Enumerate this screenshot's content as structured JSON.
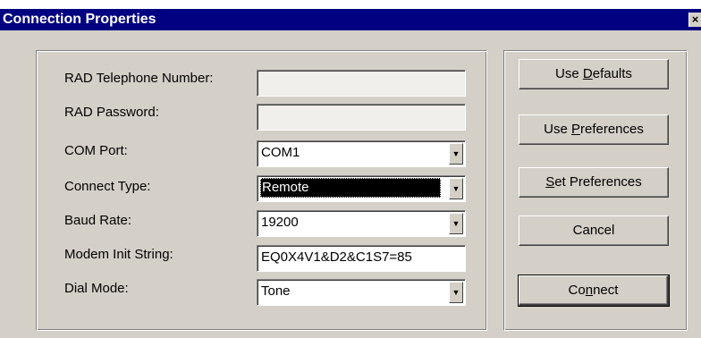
{
  "window": {
    "title": "Connection Properties",
    "close_glyph": "×"
  },
  "form": {
    "telephone_label": "RAD Telephone Number:",
    "telephone_value": "",
    "password_label": "RAD Password:",
    "password_value": "",
    "com_port_label": "COM Port:",
    "com_port_value": "COM1",
    "connect_type_label": "Connect Type:",
    "connect_type_value": "Remote",
    "baud_rate_label": "Baud Rate:",
    "baud_rate_value": "19200",
    "modem_init_label": "Modem Init String:",
    "modem_init_value": "EQ0X4V1&D2&C1S7=85",
    "dial_mode_label": "Dial Mode:",
    "dial_mode_value": "Tone"
  },
  "buttons": {
    "use_defaults_pre": "Use ",
    "use_defaults_key": "D",
    "use_defaults_post": "efaults",
    "use_preferences_pre": "Use ",
    "use_preferences_key": "P",
    "use_preferences_post": "references",
    "set_preferences_pre": "",
    "set_preferences_key": "S",
    "set_preferences_post": "et Preferences",
    "cancel": "Cancel",
    "connect_pre": "Co",
    "connect_key": "n",
    "connect_post": "nect"
  },
  "icons": {
    "dropdown_arrow": "▼",
    "close": "close-icon",
    "dropdown": "chevron-down-icon"
  }
}
